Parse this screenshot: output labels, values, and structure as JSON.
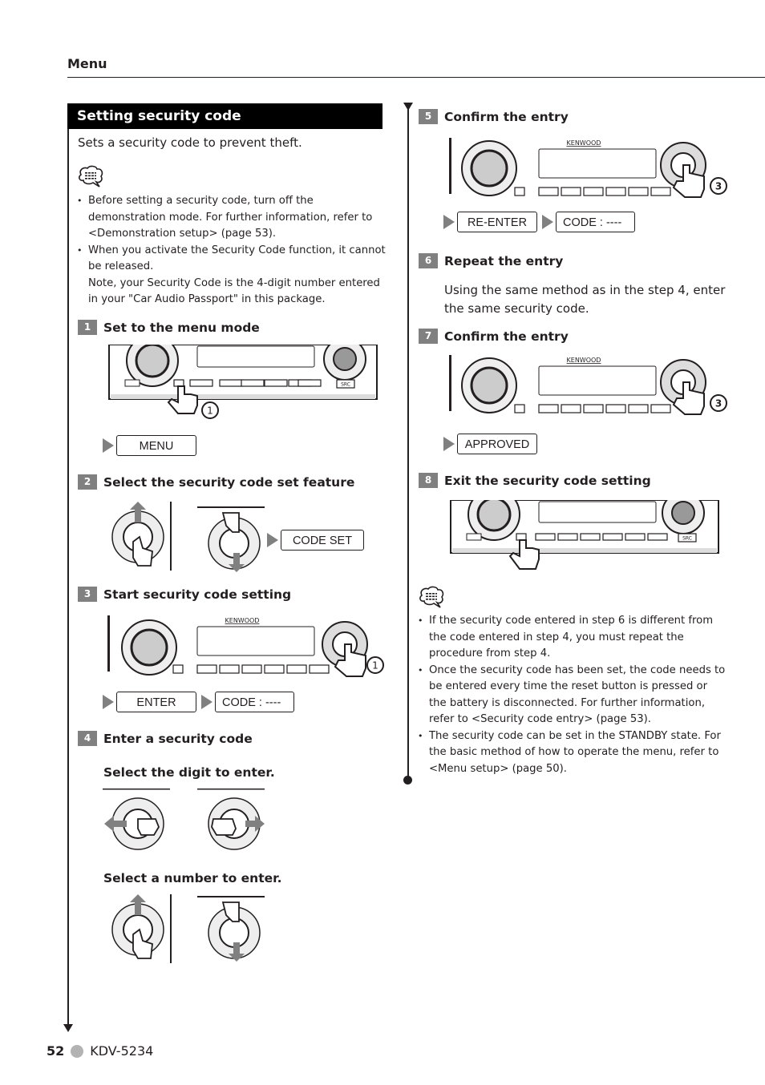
{
  "header": {
    "section": "Menu"
  },
  "title": "Setting security code",
  "subtitle": "Sets a security code to prevent theft.",
  "note_top": {
    "icon": "note-icon",
    "items": [
      "Before setting a security code, turn off the demonstration mode. For further information, refer to <Demonstration setup> (page 53).",
      "When you activate the Security Code function, it cannot be released.",
      "Note, your Security Code is the 4-digit number entered in your \"Car Audio Passport\" in this package."
    ]
  },
  "steps": [
    {
      "num": "1",
      "title": "Set to the menu mode",
      "display": [
        "MENU"
      ],
      "hold_seconds": "1"
    },
    {
      "num": "2",
      "title": "Select the security code set feature",
      "display": [
        "CODE SET"
      ]
    },
    {
      "num": "3",
      "title": "Start security code setting",
      "display": [
        "ENTER",
        "CODE : ----"
      ],
      "hold_seconds": "1"
    },
    {
      "num": "4",
      "title": "Enter a security code",
      "sub1": "Select the digit to enter.",
      "sub2": "Select a number to enter."
    },
    {
      "num": "5",
      "title": "Confirm the entry",
      "display": [
        "RE-ENTER",
        "CODE : ----"
      ],
      "hold_seconds": "3"
    },
    {
      "num": "6",
      "title": "Repeat the entry",
      "text": "Using the same method as in the step 4, enter the same security code."
    },
    {
      "num": "7",
      "title": "Confirm the entry",
      "display": [
        "APPROVED"
      ],
      "hold_seconds": "3"
    },
    {
      "num": "8",
      "title": "Exit the security code setting"
    }
  ],
  "device": {
    "brand": "KENWOOD",
    "src_label": "SRC"
  },
  "note_bottom": {
    "icon": "note-icon",
    "items": [
      "If the security code entered in step 6 is different from the code entered in step 4, you must repeat the procedure from step 4.",
      "Once the security code has been set, the code needs to be entered every time the reset button is pressed or the battery is disconnected. For further information, refer to <Security code entry> (page 53).",
      "The security code can be set in the STANDBY state. For the basic method of how to operate the menu, refer to <Menu setup> (page 50)."
    ]
  },
  "footer": {
    "page": "52",
    "model": "KDV-5234"
  }
}
